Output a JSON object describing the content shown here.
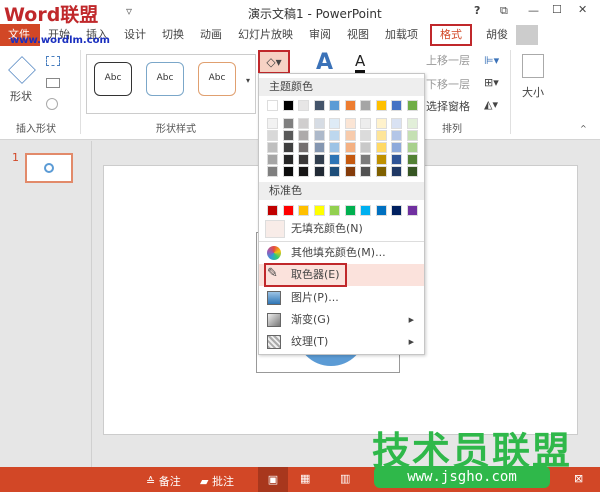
{
  "title": "演示文稿1 - PowerPoint",
  "watermark_top": {
    "brand": "Word联盟",
    "url": "www.wordlm.com"
  },
  "window_controls": {
    "help": "?",
    "restore": "⧉",
    "minimize": "—",
    "maximize": "☐",
    "close": "✕"
  },
  "tabs": [
    "文件",
    "开始",
    "插入",
    "设计",
    "切换",
    "动画",
    "幻灯片放映",
    "审阅",
    "视图",
    "加载项",
    "格式"
  ],
  "active_tab": "格式",
  "user": "胡俊",
  "ribbon": {
    "insert_shapes": {
      "label": "插入形状",
      "shape_btn": "形状"
    },
    "shape_styles": {
      "label": "形状样式",
      "styles": [
        "Abc",
        "Abc",
        "Abc"
      ]
    },
    "arrange": {
      "label": "排列",
      "bring_forward": "上移一层",
      "send_backward": "下移一层",
      "selection_pane": "选择窗格"
    },
    "size": {
      "label": "大小"
    }
  },
  "fill_menu": {
    "theme_header": "主题颜色",
    "theme_colors": [
      "#ffffff",
      "#000000",
      "#e7e6e6",
      "#44546a",
      "#5b9bd5",
      "#ed7d31",
      "#a5a5a5",
      "#ffc000",
      "#4472c4",
      "#70ad47"
    ],
    "shades": [
      [
        "#f2f2f2",
        "#7f7f7f",
        "#d0cece",
        "#d6dce4",
        "#deebf6",
        "#fbe5d5",
        "#ededed",
        "#fff2cc",
        "#d9e2f3",
        "#e2efd9"
      ],
      [
        "#d8d8d8",
        "#595959",
        "#aeabab",
        "#adb9ca",
        "#bdd7ee",
        "#f7cbac",
        "#dbdbdb",
        "#fee599",
        "#b4c6e7",
        "#c5e0b3"
      ],
      [
        "#bfbfbf",
        "#3f3f3f",
        "#757070",
        "#8496b0",
        "#9cc3e5",
        "#f4b183",
        "#c9c9c9",
        "#ffd965",
        "#8eaadb",
        "#a8d08d"
      ],
      [
        "#a5a5a5",
        "#262626",
        "#3a3838",
        "#323f4f",
        "#2e75b5",
        "#c55a11",
        "#7b7b7b",
        "#bf9000",
        "#2f5496",
        "#538135"
      ],
      [
        "#7f7f7f",
        "#0c0c0c",
        "#171616",
        "#222a35",
        "#1e4e79",
        "#843c0b",
        "#525252",
        "#7f6000",
        "#1f3864",
        "#375623"
      ]
    ],
    "standard_header": "标准色",
    "standard_colors": [
      "#c00000",
      "#ff0000",
      "#ffc000",
      "#ffff00",
      "#92d050",
      "#00b050",
      "#00b0f0",
      "#0070c0",
      "#002060",
      "#7030a0"
    ],
    "items": [
      {
        "label": "无填充颜色(N)"
      },
      {
        "label": "其他填充颜色(M)..."
      },
      {
        "label": "取色器(E)"
      },
      {
        "label": "图片(P)..."
      },
      {
        "label": "渐变(G)"
      },
      {
        "label": "纹理(T)"
      }
    ]
  },
  "slide_number": "1",
  "status": {
    "notes": "备注",
    "comments": "批注"
  },
  "watermark_bottom": {
    "brand": "技术员联盟",
    "url": "www.jsgho.com"
  }
}
